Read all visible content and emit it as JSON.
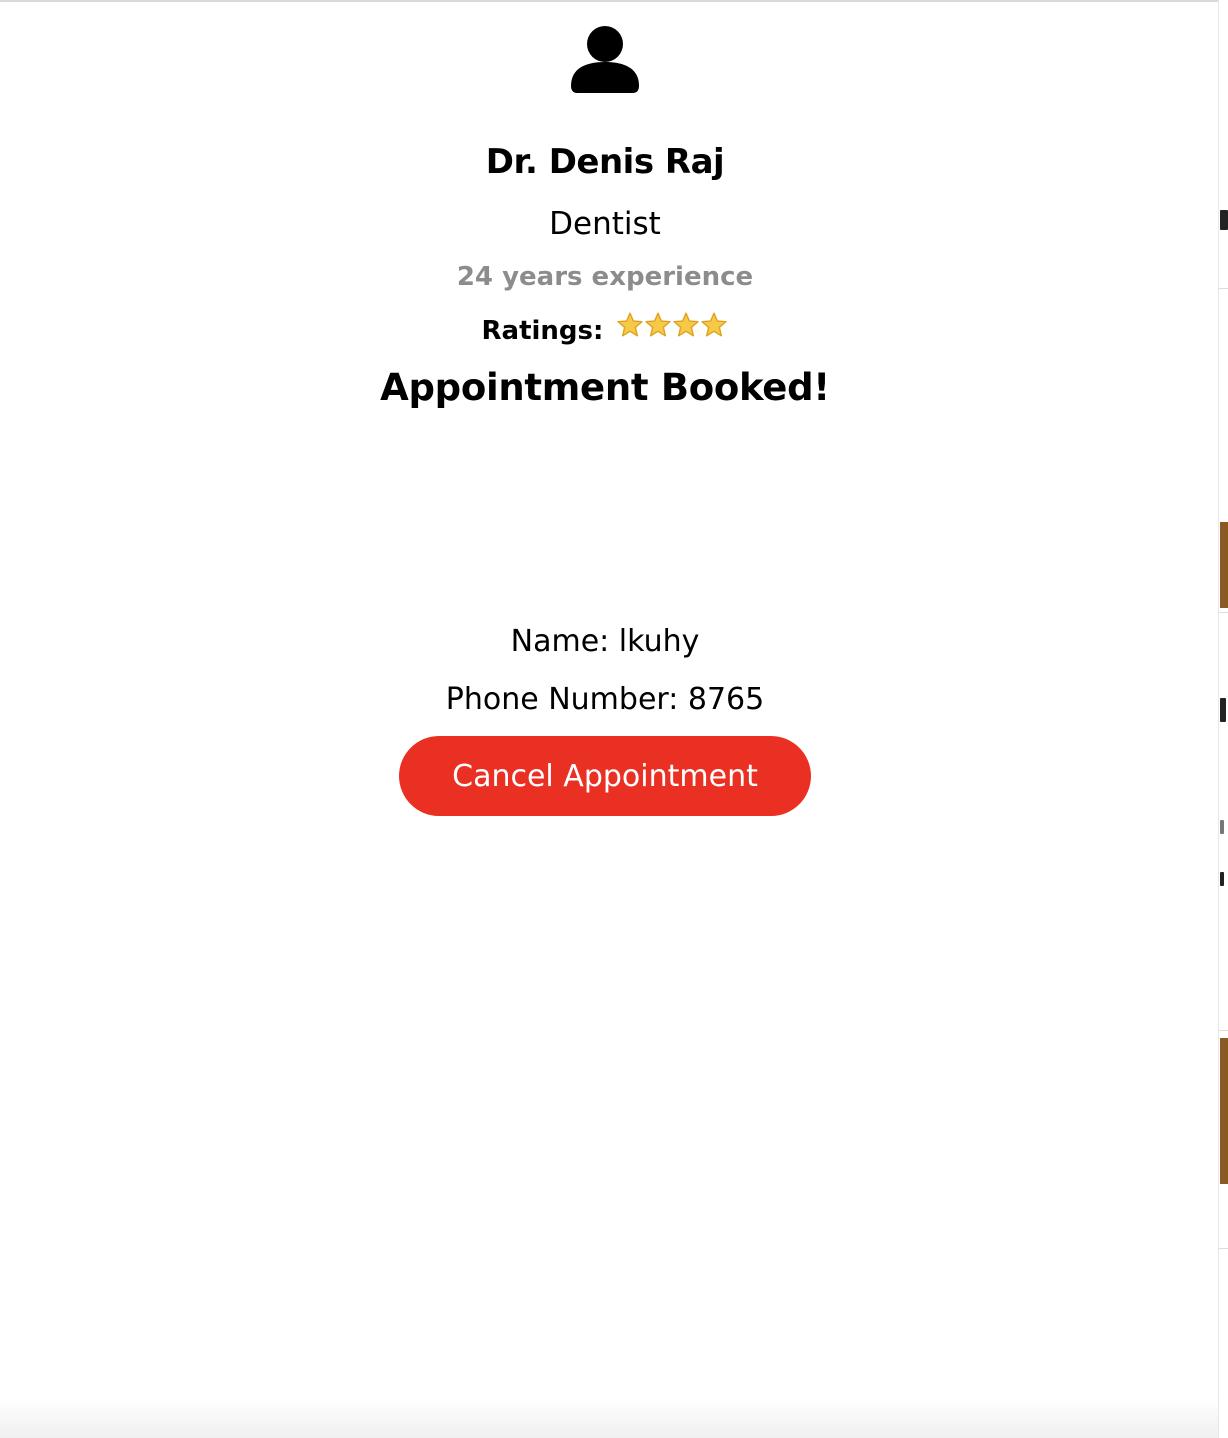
{
  "doctor": {
    "name": "Dr. Denis Raj",
    "speciality": "Dentist",
    "experience": "24 years experience",
    "ratings_label": "Ratings:",
    "rating_stars": 4
  },
  "appointment": {
    "status": "Appointment Booked!",
    "name_line": "Name: lkuhy",
    "phone_line": "Phone Number: 8765",
    "cancel_label": "Cancel Appointment"
  },
  "colors": {
    "cancel_button": "#ea3023",
    "experience_text": "#8c8c8c",
    "star": "#f7c948"
  },
  "icons": {
    "avatar": "user-icon",
    "rating": "star-icon"
  }
}
